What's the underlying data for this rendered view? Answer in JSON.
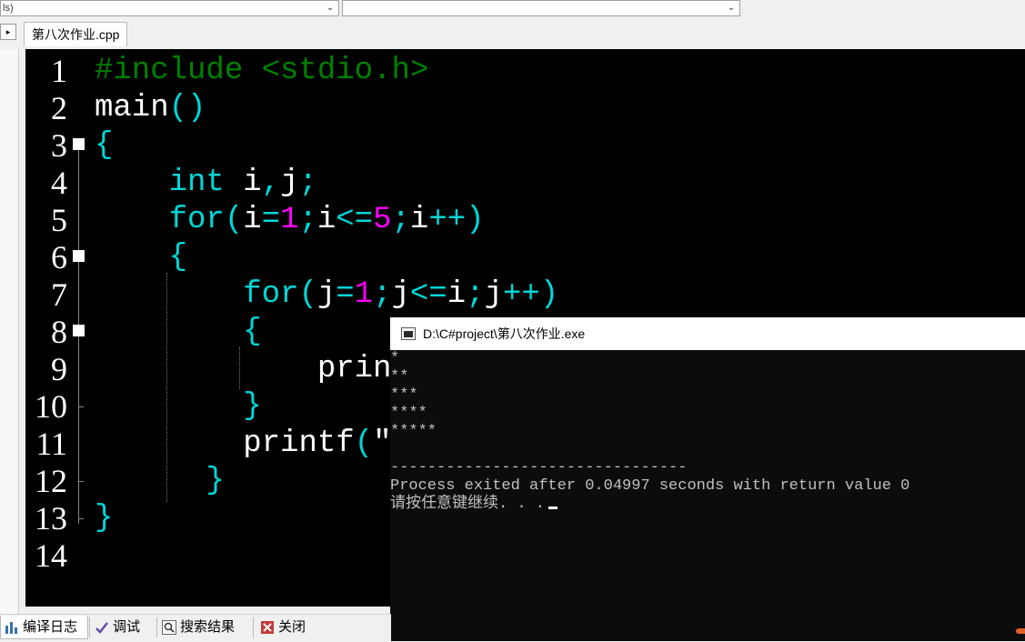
{
  "toolbar": {
    "combo1_text": "ls)",
    "combo2_text": ""
  },
  "tabs": {
    "expander": "▸",
    "file_tab": "第八次作业.cpp"
  },
  "editor": {
    "line_numbers": [
      "1",
      "2",
      "3",
      "4",
      "5",
      "6",
      "7",
      "8",
      "9",
      "10",
      "11",
      "12",
      "13",
      "14"
    ],
    "lines": [
      [
        {
          "t": "#include <stdio.h>",
          "c": "pre"
        }
      ],
      [
        {
          "t": "main",
          "c": "id"
        },
        {
          "t": "()",
          "c": "br"
        }
      ],
      [
        {
          "t": "{",
          "c": "br"
        }
      ],
      [
        {
          "t": "    ",
          "c": "id"
        },
        {
          "t": "int",
          "c": "kw"
        },
        {
          "t": " i",
          "c": "id"
        },
        {
          "t": ",",
          "c": "br"
        },
        {
          "t": "j",
          "c": "id"
        },
        {
          "t": ";",
          "c": "br"
        }
      ],
      [
        {
          "t": "    ",
          "c": "id"
        },
        {
          "t": "for",
          "c": "kw"
        },
        {
          "t": "(",
          "c": "br"
        },
        {
          "t": "i",
          "c": "id"
        },
        {
          "t": "=",
          "c": "br"
        },
        {
          "t": "1",
          "c": "num"
        },
        {
          "t": ";",
          "c": "br"
        },
        {
          "t": "i",
          "c": "id"
        },
        {
          "t": "<=",
          "c": "br"
        },
        {
          "t": "5",
          "c": "num"
        },
        {
          "t": ";",
          "c": "br"
        },
        {
          "t": "i",
          "c": "id"
        },
        {
          "t": "++)",
          "c": "br"
        }
      ],
      [
        {
          "t": "    ",
          "c": "id"
        },
        {
          "t": "{",
          "c": "br"
        }
      ],
      [
        {
          "t": "        ",
          "c": "id"
        },
        {
          "t": "for",
          "c": "kw"
        },
        {
          "t": "(",
          "c": "br"
        },
        {
          "t": "j",
          "c": "id"
        },
        {
          "t": "=",
          "c": "br"
        },
        {
          "t": "1",
          "c": "num"
        },
        {
          "t": ";",
          "c": "br"
        },
        {
          "t": "j",
          "c": "id"
        },
        {
          "t": "<=",
          "c": "br"
        },
        {
          "t": "i",
          "c": "id"
        },
        {
          "t": ";",
          "c": "br"
        },
        {
          "t": "j",
          "c": "id"
        },
        {
          "t": "++)",
          "c": "br"
        }
      ],
      [
        {
          "t": "        ",
          "c": "id"
        },
        {
          "t": "{",
          "c": "br"
        }
      ],
      [
        {
          "t": "            ",
          "c": "id"
        },
        {
          "t": "prin",
          "c": "id"
        }
      ],
      [
        {
          "t": "        ",
          "c": "id"
        },
        {
          "t": "}",
          "c": "br"
        }
      ],
      [
        {
          "t": "        ",
          "c": "id"
        },
        {
          "t": "printf",
          "c": "id"
        },
        {
          "t": "(",
          "c": "br"
        },
        {
          "t": "″",
          "c": "str"
        }
      ],
      [
        {
          "t": "      ",
          "c": "id"
        },
        {
          "t": "}",
          "c": "br"
        }
      ],
      [
        {
          "t": "}",
          "c": "br"
        }
      ],
      []
    ],
    "colors": {
      "pre": "#008000",
      "kw": "#00d7d7",
      "br": "#00d7d7",
      "num": "#ff00ff",
      "id": "#ffffff",
      "str": "#ffffff"
    }
  },
  "console": {
    "title": "D:\\C#project\\第八次作业.exe",
    "output": [
      "*",
      "**",
      "***",
      "****",
      "*****",
      "",
      "--------------------------------",
      "Process exited after 0.04997 seconds with return value 0",
      "请按任意键继续. . ."
    ]
  },
  "bottom_tabs": {
    "compile_log": "编译日志",
    "debug": "调试",
    "search_results": "搜索结果",
    "close": "关闭"
  }
}
